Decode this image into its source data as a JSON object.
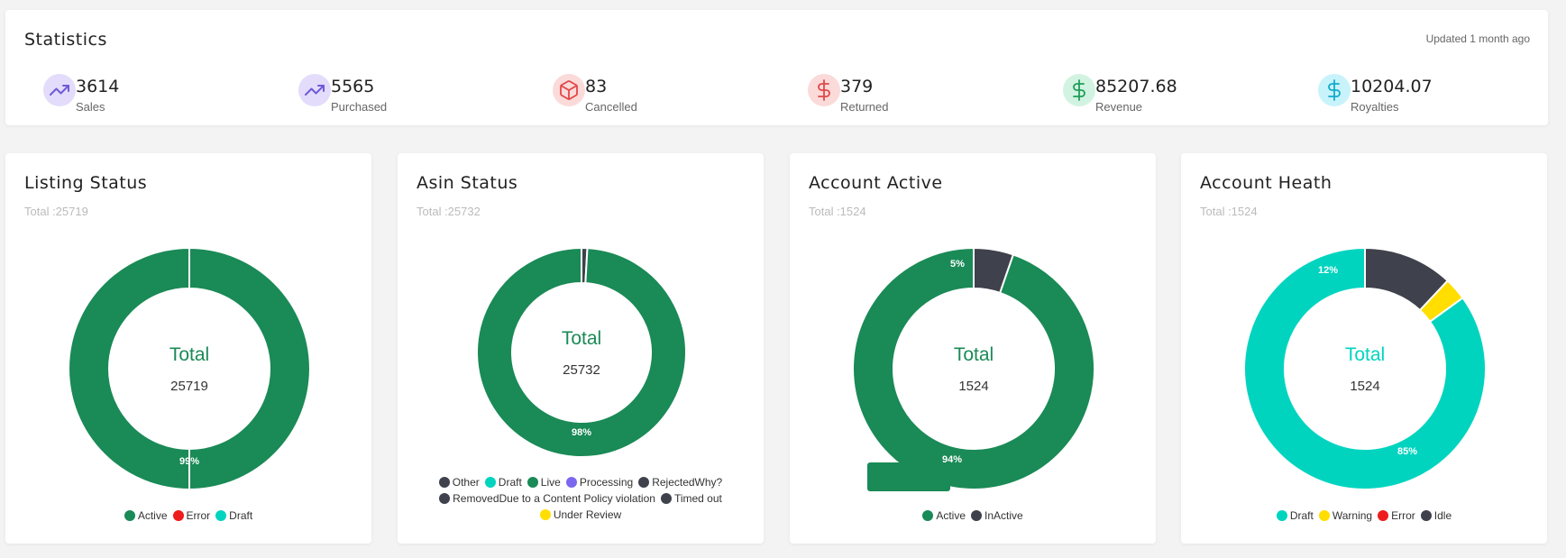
{
  "statistics": {
    "title": "Statistics",
    "updated": "Updated 1 month ago",
    "items": [
      {
        "value": "3614",
        "label": "Sales",
        "icon": "trending-up-icon",
        "color": "#6f5bd6",
        "bg": "#e3dcfb"
      },
      {
        "value": "5565",
        "label": "Purchased",
        "icon": "trending-up-icon",
        "color": "#6f5bd6",
        "bg": "#e3dcfb"
      },
      {
        "value": "83",
        "label": "Cancelled",
        "icon": "box-icon",
        "color": "#e04848",
        "bg": "#fbdada"
      },
      {
        "value": "379",
        "label": "Returned",
        "icon": "dollar-icon",
        "color": "#e04848",
        "bg": "#fbdada"
      },
      {
        "value": "85207.68",
        "label": "Revenue",
        "icon": "dollar-icon",
        "color": "#1f9e5a",
        "bg": "#d2f3e1"
      },
      {
        "value": "10204.07",
        "label": "Royalties",
        "icon": "dollar-icon",
        "color": "#11aacb",
        "bg": "#c8f3fb"
      }
    ]
  },
  "chart_data": [
    {
      "type": "pie",
      "title": "Listing Status",
      "total_text": "Total :25719",
      "center_label": "Total",
      "center_value": "25719",
      "center_color": "#1a8a56",
      "categories": [
        "Active",
        "Error",
        "Draft"
      ],
      "values": [
        25719,
        0,
        0
      ],
      "colors": [
        "#1a8a56",
        "#ee1c1c",
        "#00d4bf"
      ],
      "labels": [
        {
          "text": "99%"
        }
      ],
      "legend": [
        {
          "name": "Active",
          "color": "#1a8a56"
        },
        {
          "name": "Error",
          "color": "#ee1c1c"
        },
        {
          "name": "Draft",
          "color": "#00d4bf"
        }
      ]
    },
    {
      "type": "pie",
      "title": "Asin Status",
      "total_text": "Total :25732",
      "center_label": "Total",
      "center_value": "25732",
      "center_color": "#1a8a56",
      "categories": [
        "Other",
        "Live"
      ],
      "values": [
        230,
        25502
      ],
      "colors": [
        "#3f414c",
        "#1a8a56"
      ],
      "labels": [
        {
          "text": "98%"
        }
      ],
      "legend": [
        {
          "name": "Other",
          "color": "#3f414c"
        },
        {
          "name": "Draft",
          "color": "#00d4bf"
        },
        {
          "name": "Live",
          "color": "#1a8a56"
        },
        {
          "name": "Processing",
          "color": "#7b68ee"
        },
        {
          "name": "RejectedWhy?",
          "color": "#3f414c"
        },
        {
          "name": "RemovedDue to a Content Policy violation",
          "color": "#3f414c"
        },
        {
          "name": "Timed out",
          "color": "#3f414c"
        },
        {
          "name": "Under Review",
          "color": "#ffde00"
        }
      ]
    },
    {
      "type": "pie",
      "title": "Account Active",
      "total_text": "Total :1524",
      "center_label": "Total",
      "center_value": "1524",
      "center_color": "#1a8a56",
      "categories": [
        "InActive",
        "Active"
      ],
      "values": [
        81,
        1443
      ],
      "colors": [
        "#3f414c",
        "#1a8a56"
      ],
      "labels": [
        {
          "text": "5%"
        },
        {
          "text": "94%"
        }
      ],
      "legend": [
        {
          "name": "Active",
          "color": "#1a8a56"
        },
        {
          "name": "InActive",
          "color": "#3f414c"
        }
      ]
    },
    {
      "type": "pie",
      "title": "Account Heath",
      "total_text": "Total :1524",
      "center_label": "Total",
      "center_value": "1524",
      "center_color": "#00d4bf",
      "categories": [
        "Idle",
        "Warning",
        "Draft"
      ],
      "values": [
        183,
        46,
        1295
      ],
      "colors": [
        "#3f414c",
        "#ffde00",
        "#00d4bf"
      ],
      "labels": [
        {
          "text": "12%"
        },
        {
          "text": ""
        },
        {
          "text": "85%"
        }
      ],
      "legend": [
        {
          "name": "Draft",
          "color": "#00d4bf"
        },
        {
          "name": "Warning",
          "color": "#ffde00"
        },
        {
          "name": "Error",
          "color": "#ee1c1c"
        },
        {
          "name": "Idle",
          "color": "#3f414c"
        }
      ]
    }
  ]
}
